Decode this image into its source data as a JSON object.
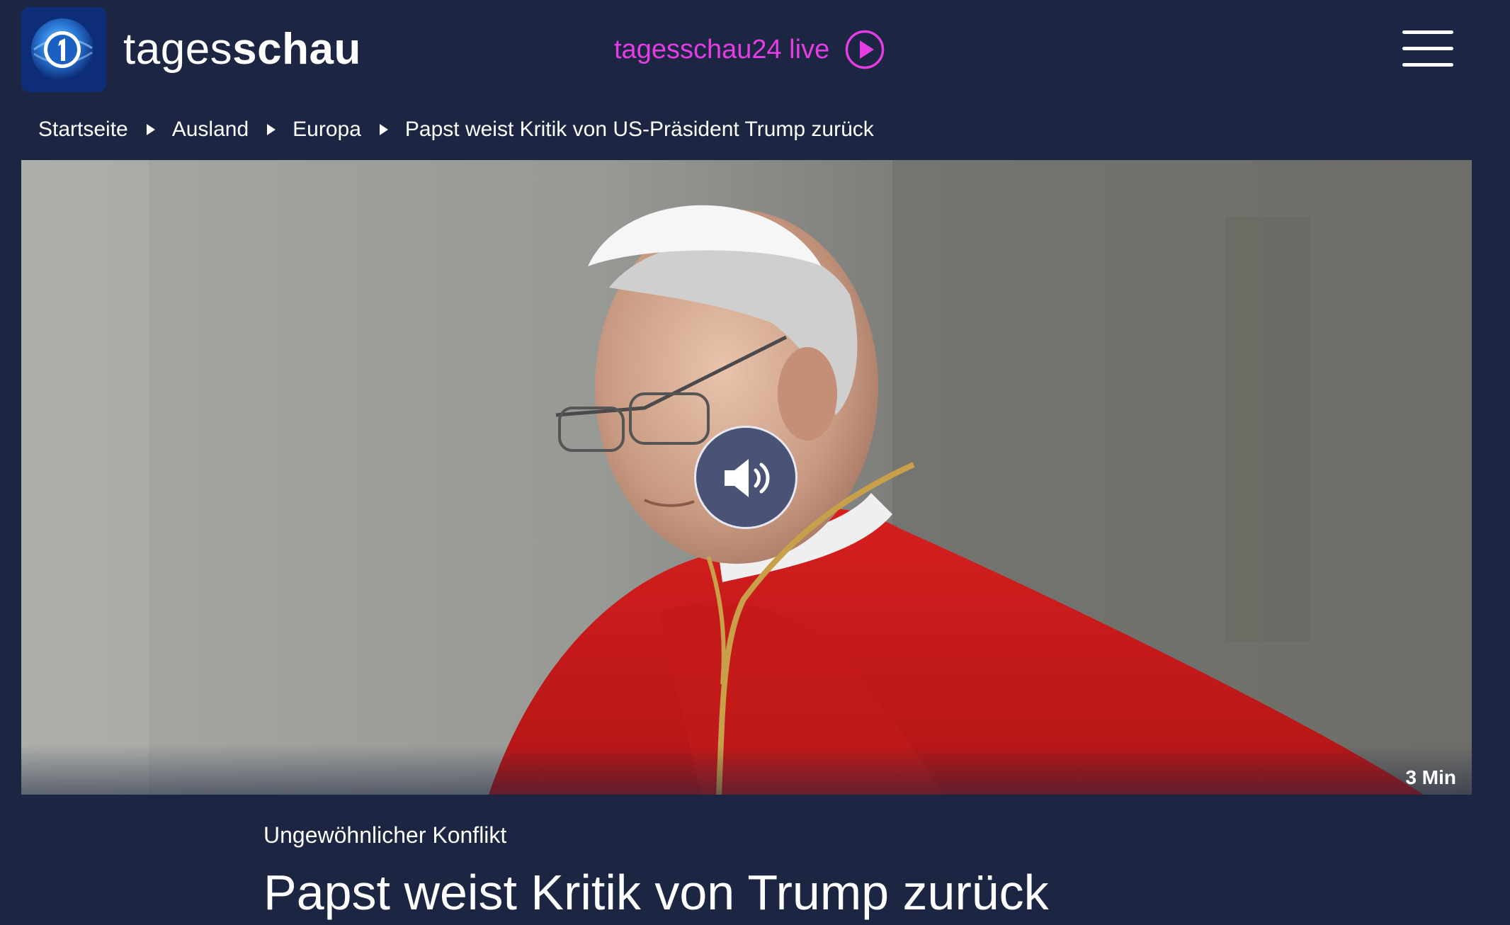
{
  "header": {
    "logo_alt": "tagesschau",
    "logo_text_regular": "tages",
    "logo_text_bold": "schau",
    "live_label": "tagesschau24 live",
    "live_color": "#e33de3"
  },
  "breadcrumb": {
    "items": [
      "Startseite",
      "Ausland",
      "Europa"
    ],
    "current": "Papst weist Kritik von US-Präsident Trump zurück"
  },
  "hero": {
    "duration": "3 Min",
    "audio_icon": "speaker-volume-icon"
  },
  "article": {
    "kicker": "Ungewöhnlicher Konflikt",
    "headline": "Papst weist Kritik von Trump zurück"
  },
  "colors": {
    "background": "#1c2541",
    "accent_live": "#e33de3",
    "audio_button": "#4a5276"
  }
}
